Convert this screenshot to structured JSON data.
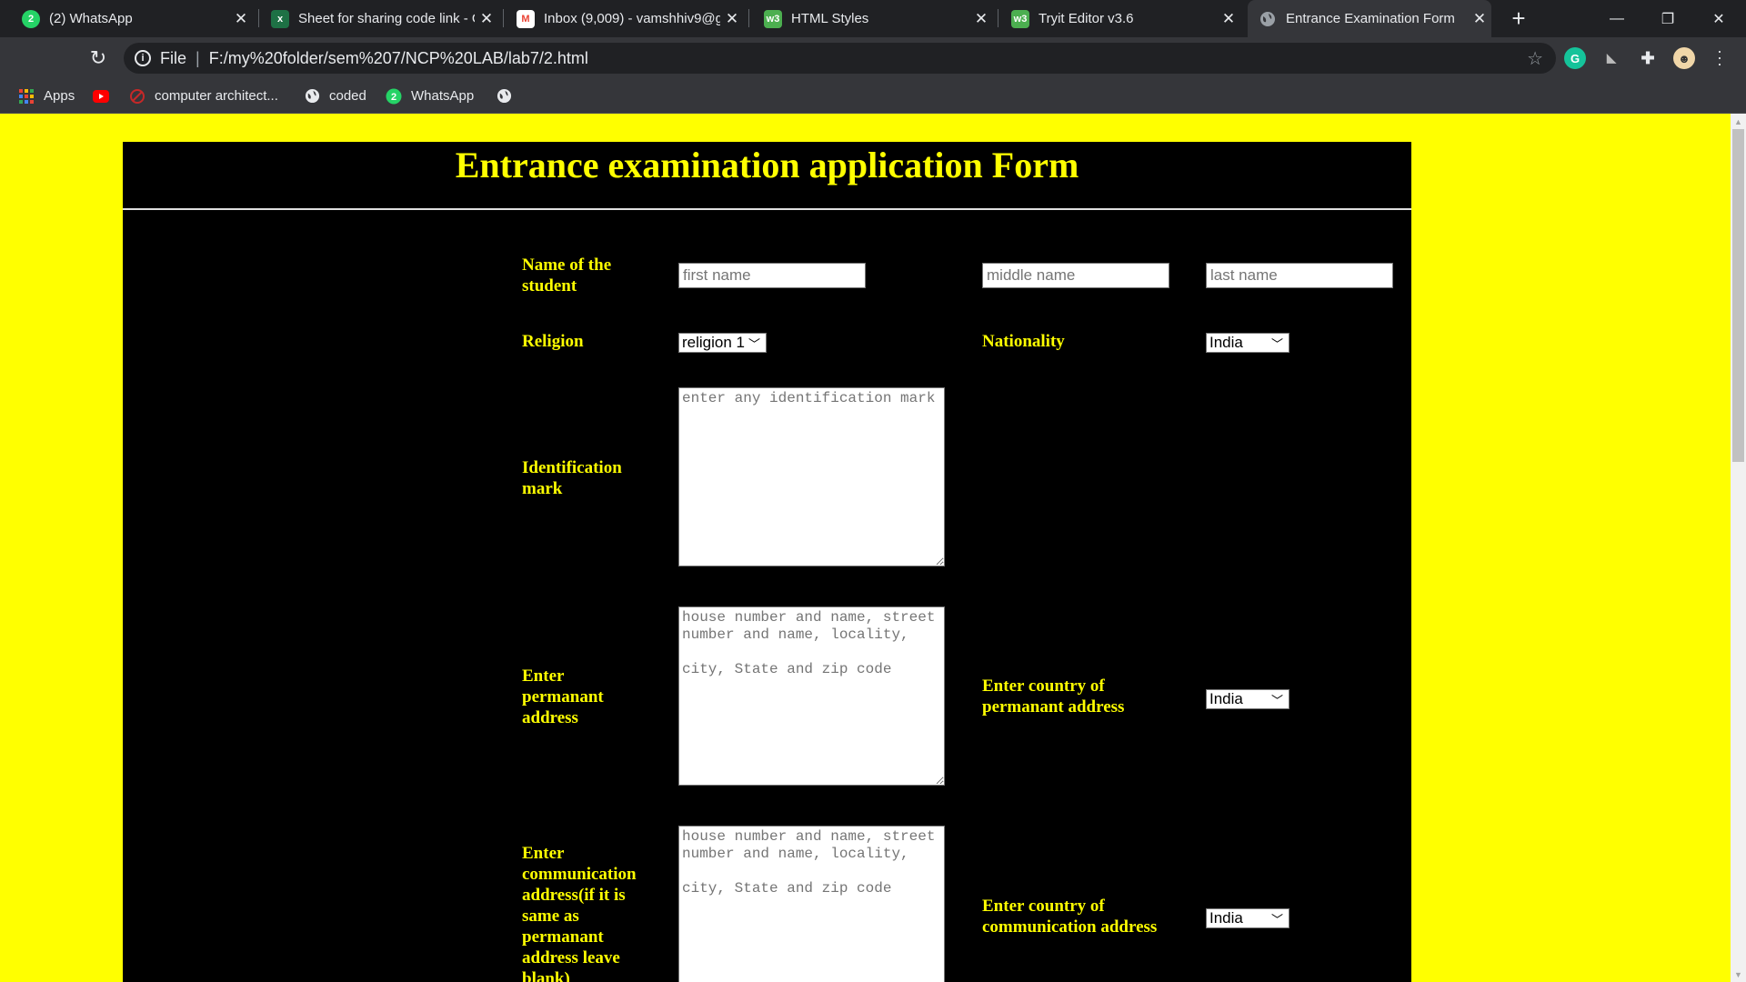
{
  "browser": {
    "tabs": [
      {
        "title": "(2) WhatsApp",
        "icon": "whatsapp-icon",
        "color": "#25d366"
      },
      {
        "title": "Sheet for sharing code link - G",
        "icon": "excel-icon",
        "color": "#1e7145"
      },
      {
        "title": "Inbox (9,009) - vamshhiv9@g",
        "icon": "gmail-icon",
        "color": "#ea4335"
      },
      {
        "title": "HTML Styles",
        "icon": "w3schools-icon",
        "color": "#4caf50"
      },
      {
        "title": "Tryit Editor v3.6",
        "icon": "w3schools-icon",
        "color": "#4caf50"
      },
      {
        "title": "Entrance Examination Form",
        "icon": "globe-icon",
        "color": "#9aa0a6"
      }
    ],
    "address": {
      "scheme_label": "File",
      "url": "F:/my%20folder/sem%207/NCP%20LAB/lab7/2.html"
    },
    "bookmarks": [
      {
        "label": "Apps",
        "icon": "apps-grid-icon"
      },
      {
        "label": "",
        "icon": "youtube-icon"
      },
      {
        "label": "computer architect...",
        "icon": "bookmark-site-icon"
      },
      {
        "label": "coded",
        "icon": "globe-icon"
      },
      {
        "label": "WhatsApp",
        "icon": "whatsapp-icon"
      },
      {
        "label": "",
        "icon": "globe-icon"
      }
    ]
  },
  "form": {
    "title": "Entrance examination application Form",
    "name_label": "Name of the student",
    "first_name_placeholder": "first name",
    "middle_name_placeholder": "middle name",
    "last_name_placeholder": "last name",
    "religion_label": "Religion",
    "religion_value": "religion 1",
    "nationality_label": "Nationality",
    "nationality_value": "India",
    "identification_label": "Identification mark",
    "identification_placeholder": "enter any identification mark",
    "permanent_label": "Enter permanant address",
    "permanent_placeholder": "house number and name, street number and name, locality,\n\ncity, State and zip code",
    "permanent_country_label": "Enter country of permanant address",
    "permanent_country_value": "India",
    "communication_label": "Enter communication address(if it is same as permanant address leave blank)",
    "communication_placeholder": "house number and name, street number and name, locality,\n\ncity, State and zip code",
    "communication_country_label": "Enter country of communication address",
    "communication_country_value": "India"
  },
  "colors": {
    "page_background": "#ffff00",
    "form_background": "#000000",
    "label_text": "#ffff00"
  }
}
